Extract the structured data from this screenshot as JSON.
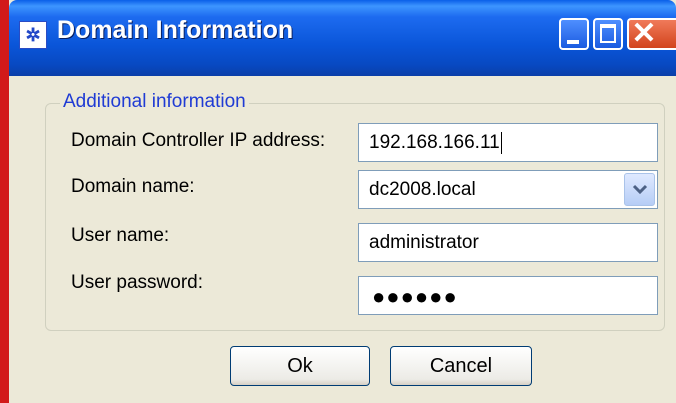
{
  "window": {
    "title": "Domain Information",
    "icon": "app-icon"
  },
  "group": {
    "legend": "Additional information"
  },
  "fields": {
    "dc_ip": {
      "label": "Domain Controller IP address:",
      "value": "192.168.166.11"
    },
    "domain": {
      "label": "Domain name:",
      "value": "dc2008.local"
    },
    "user": {
      "label": "User name:",
      "value": "administrator"
    },
    "password": {
      "label": "User password:",
      "value": "●●●●●●"
    }
  },
  "buttons": {
    "ok": "Ok",
    "cancel": "Cancel"
  },
  "colors": {
    "titlebar": "#0a55d8",
    "legend": "#1f3bd4",
    "close": "#d2441c",
    "dialog_bg": "#ece9d8"
  }
}
